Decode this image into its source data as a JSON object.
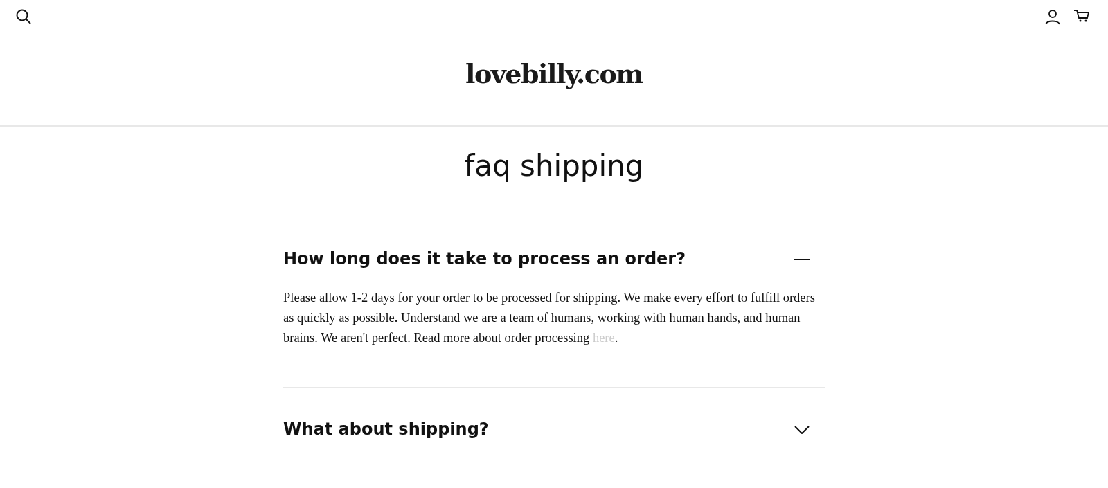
{
  "header": {
    "logo": "lovebilly.com"
  },
  "page_title": "faq shipping",
  "faqs": [
    {
      "question": "How long does it take to process an order?",
      "expanded": true,
      "answer": "Please allow 1-2 days for your order to be processed for shipping. We make every effort to fulfill orders as quickly as possible. Understand we are a team of humans, working with human hands, and human brains. We aren't perfect. Read more about order processing ",
      "link": "here",
      "answer_end": "."
    },
    {
      "question": "What about shipping?",
      "expanded": false
    }
  ]
}
